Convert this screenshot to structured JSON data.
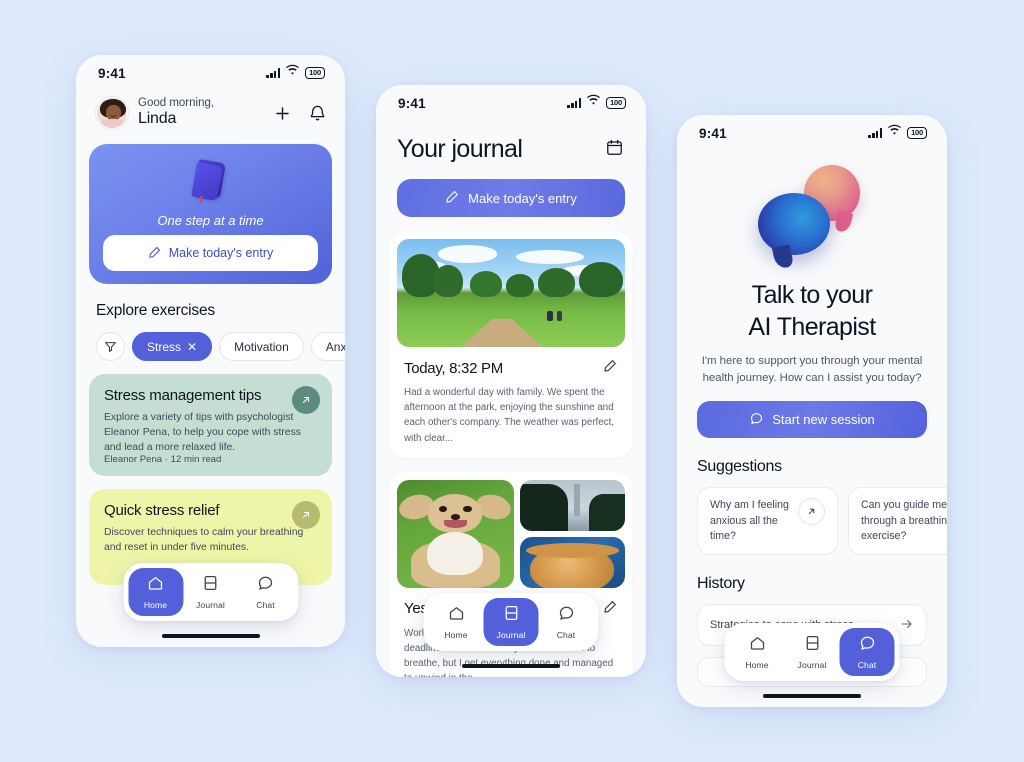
{
  "background_color": "#dfeafc",
  "accent_color": "#5360d9",
  "phone_home": {
    "status": {
      "time": "9:41",
      "battery": "100",
      "signal_icon": "signal-icon",
      "wifi_icon": "wifi-icon"
    },
    "header": {
      "greeting": "Good morning,",
      "name": "Linda",
      "add_icon": "plus-icon",
      "bell_icon": "bell-icon",
      "avatar": "user-avatar"
    },
    "hero": {
      "book_icon": "book-icon",
      "tagline": "One step at a time",
      "cta_label": "Make today's entry",
      "cta_icon": "pencil-icon"
    },
    "explore": {
      "title": "Explore exercises",
      "filter_icon": "filter-icon",
      "chips": [
        {
          "label": "Stress",
          "selected": true,
          "close_icon": "close-icon"
        },
        {
          "label": "Motivation",
          "selected": false
        },
        {
          "label": "Anxiety",
          "selected": false
        }
      ]
    },
    "cards": [
      {
        "title": "Stress management tips",
        "body": "Explore a variety of tips with psychologist Eleanor Pena, to help you cope with stress and lead a more relaxed life.",
        "meta": "Eleanor Pena · 12 min read",
        "color": "#c5ded4",
        "arrow_icon": "arrow-up-right-icon"
      },
      {
        "title": "Quick stress relief",
        "body": "Discover techniques to calm your breathing and reset in under five minutes.",
        "meta": "",
        "color": "#eef5a8",
        "arrow_icon": "arrow-up-right-icon"
      }
    ],
    "nav": [
      {
        "label": "Home",
        "icon": "home-icon",
        "active": true
      },
      {
        "label": "Journal",
        "icon": "book-nav-icon",
        "active": false
      },
      {
        "label": "Chat",
        "icon": "chat-icon",
        "active": false
      }
    ]
  },
  "phone_journal": {
    "status": {
      "time": "9:41",
      "battery": "100",
      "signal_icon": "signal-icon",
      "wifi_icon": "wifi-icon"
    },
    "title": "Your journal",
    "calendar_icon": "calendar-icon",
    "entry_button": {
      "label": "Make today's entry",
      "icon": "pencil-icon"
    },
    "entries": [
      {
        "date": "Today, 8:32 PM",
        "edit_icon": "pencil-edit-icon",
        "text": "Had a wonderful day with family. We spent the afternoon at the park, enjoying the sunshine and each other's company. The weather was perfect, with clear...",
        "photo_kind": "park-photo"
      },
      {
        "date": "Yesterday, 6:25 PM",
        "edit_icon": "pencil-edit-icon",
        "text": "Work was hectic today with back-to-back deadlines to meet. I barely had a moment to breathe, but I get everything done and managed to unwind in the...",
        "photo_kind": "dog-city-pie-collage"
      }
    ],
    "nav": [
      {
        "label": "Home",
        "icon": "home-icon",
        "active": false
      },
      {
        "label": "Journal",
        "icon": "book-nav-icon",
        "active": true
      },
      {
        "label": "Chat",
        "icon": "chat-icon",
        "active": false
      }
    ]
  },
  "phone_chat": {
    "status": {
      "time": "9:41",
      "battery": "100",
      "signal_icon": "signal-icon",
      "wifi_icon": "wifi-icon"
    },
    "illustration": "speech-bubbles-3d",
    "heading_line1": "Talk to your",
    "heading_line2": "AI Therapist",
    "subtitle": "I'm here to support you through your mental health journey. How can I assist you today?",
    "start_button": {
      "label": "Start new session",
      "icon": "chat-icon"
    },
    "suggestions_title": "Suggestions",
    "suggestions": [
      {
        "text": "Why am I feeling anxious all the time?",
        "arrow_icon": "arrow-up-right-icon"
      },
      {
        "text": "Can you guide me through a breathing exercise?",
        "arrow_icon": "arrow-up-right-icon"
      }
    ],
    "history_title": "History",
    "history": [
      {
        "label": "Strategies to cope with stress",
        "arrow_icon": "arrow-right-icon"
      }
    ],
    "nav": [
      {
        "label": "Home",
        "icon": "home-icon",
        "active": false
      },
      {
        "label": "Journal",
        "icon": "book-nav-icon",
        "active": false
      },
      {
        "label": "Chat",
        "icon": "chat-icon",
        "active": true
      }
    ]
  }
}
